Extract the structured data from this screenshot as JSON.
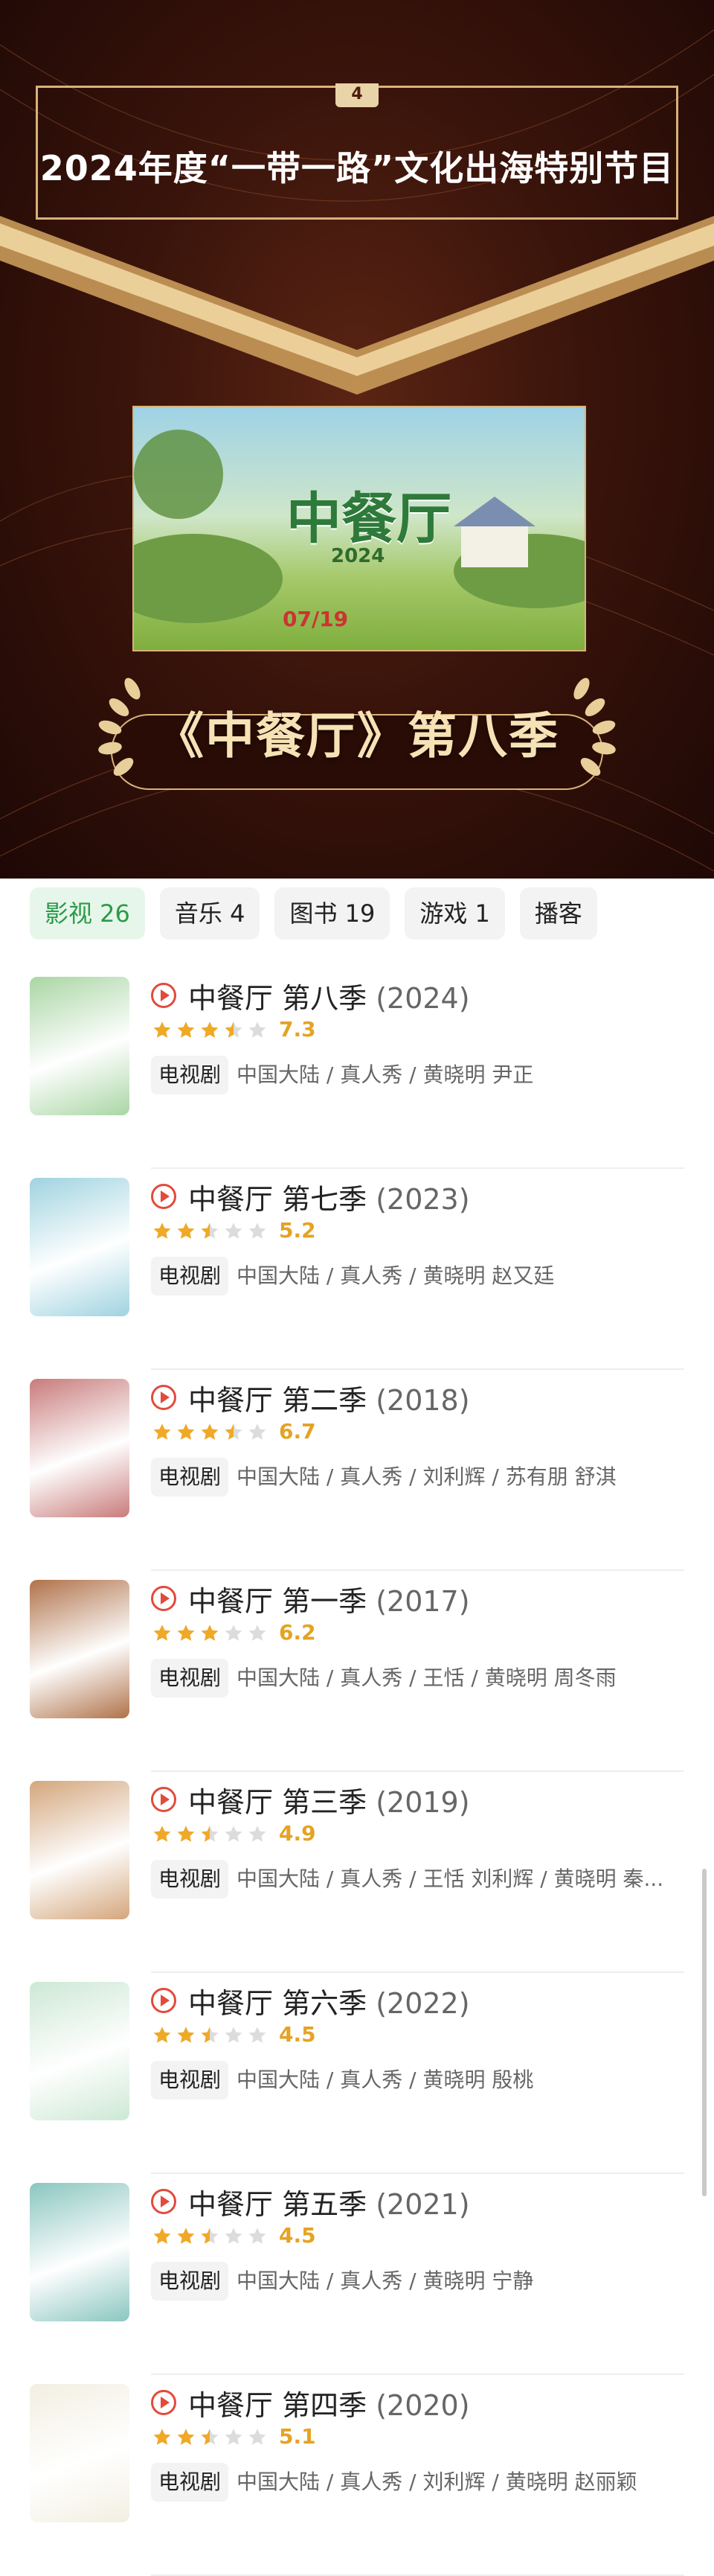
{
  "banner": {
    "rank_number": "4",
    "title": "2024年度“一带一路”文化出海特别节目",
    "poster": {
      "logo_text": "中餐厅",
      "year_text": "2024",
      "date_text": "07/19"
    },
    "show_title": "《中餐厅》第八季"
  },
  "tabs": [
    {
      "label": "影视 26",
      "active": true
    },
    {
      "label": "音乐 4",
      "active": false
    },
    {
      "label": "图书 19",
      "active": false
    },
    {
      "label": "游戏 1",
      "active": false
    },
    {
      "label": "播客",
      "active": false
    }
  ],
  "colors": {
    "accent_green": "#2c9a49",
    "star": "#f0a926",
    "play": "#e24a3b"
  },
  "items": [
    {
      "title": "中餐厅 第八季",
      "year": "(2024)",
      "rating": 3.5,
      "score": "7.3",
      "type": "电视剧",
      "meta": "中国大陆 / 真人秀 / 黄晓明 尹正",
      "cover_color": "#a9d6a4"
    },
    {
      "title": "中餐厅 第七季",
      "year": "(2023)",
      "rating": 2.5,
      "score": "5.2",
      "type": "电视剧",
      "meta": "中国大陆 / 真人秀 / 黄晓明 赵又廷",
      "cover_color": "#9fd3e0"
    },
    {
      "title": "中餐厅 第二季",
      "year": "(2018)",
      "rating": 3.5,
      "score": "6.7",
      "type": "电视剧",
      "meta": "中国大陆 / 真人秀 / 刘利辉 / 苏有朋 舒淇",
      "cover_color": "#c97b7b"
    },
    {
      "title": "中餐厅 第一季",
      "year": "(2017)",
      "rating": 3,
      "score": "6.2",
      "type": "电视剧",
      "meta": "中国大陆 / 真人秀 / 王恬 / 黄晓明 周冬雨",
      "cover_color": "#b0724a"
    },
    {
      "title": "中餐厅 第三季",
      "year": "(2019)",
      "rating": 2.5,
      "score": "4.9",
      "type": "电视剧",
      "meta": "中国大陆 / 真人秀 / 王恬 刘利辉 / 黄晓明 秦...",
      "cover_color": "#d4a67c"
    },
    {
      "title": "中餐厅 第六季",
      "year": "(2022)",
      "rating": 2.5,
      "score": "4.5",
      "type": "电视剧",
      "meta": "中国大陆 / 真人秀 / 黄晓明 殷桃",
      "cover_color": "#cde8d4"
    },
    {
      "title": "中餐厅 第五季",
      "year": "(2021)",
      "rating": 2.5,
      "score": "4.5",
      "type": "电视剧",
      "meta": "中国大陆 / 真人秀 / 黄晓明 宁静",
      "cover_color": "#8ac6c0"
    },
    {
      "title": "中餐厅 第四季",
      "year": "(2020)",
      "rating": 2.5,
      "score": "5.1",
      "type": "电视剧",
      "meta": "中国大陆 / 真人秀 / 刘利辉 / 黄晓明 赵丽颖",
      "cover_color": "#f2efe1"
    }
  ]
}
